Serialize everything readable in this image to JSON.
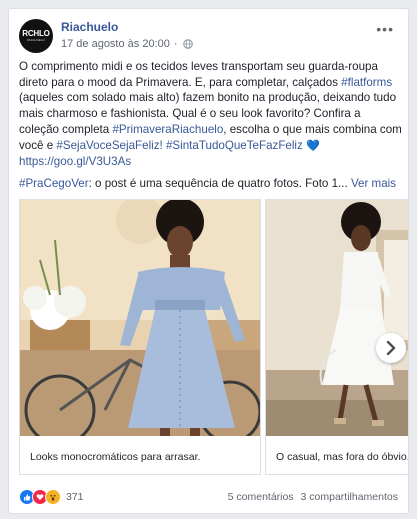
{
  "post": {
    "page_name": "Riachuelo",
    "avatar_text": "RCHLO",
    "avatar_sub": "RIACHUELO",
    "date": "17 de agosto às 20:00",
    "dot": "·",
    "more": "•••",
    "body": {
      "p1_a": "O comprimento midi e os tecidos leves transportam seu guarda-roupa direto para o mood da Primavera. E, para completar, calçados ",
      "p1_tag": "#flatforms",
      "p1_b": " (aqueles com solado mais alto) fazem bonito na produção, deixando tudo mais charmoso e fashionista. Qual é o seu look favorito? Confira a coleção completa ",
      "p1_tag2": "#PrimaveraRiachuelo",
      "p1_c": ", escolha o que mais combina com você e ",
      "p1_tag3": "#SejaVoceSejaFeliz!",
      "p1_tag4": "#SintaTudoQueTeFazFeliz",
      "p1_emoji": "💙",
      "link": "https://goo.gl/V3U3As",
      "p3_tag": "#PraCegoVer",
      "p3_text": ": o post é uma sequência de quatro fotos. Foto 1...",
      "see_more": "Ver mais"
    }
  },
  "carousel": {
    "slides": [
      {
        "caption": "Looks monocromáticos para arrasar."
      },
      {
        "caption": "O casual, mas fora do óbvio."
      }
    ]
  },
  "footer": {
    "reaction_count": "371",
    "comments": "5 comentários",
    "shares": "3 compartilhamentos"
  },
  "colors": {
    "link": "#385898",
    "like": "#1877f2",
    "love": "#f0284a",
    "wow": "#f7b125"
  }
}
